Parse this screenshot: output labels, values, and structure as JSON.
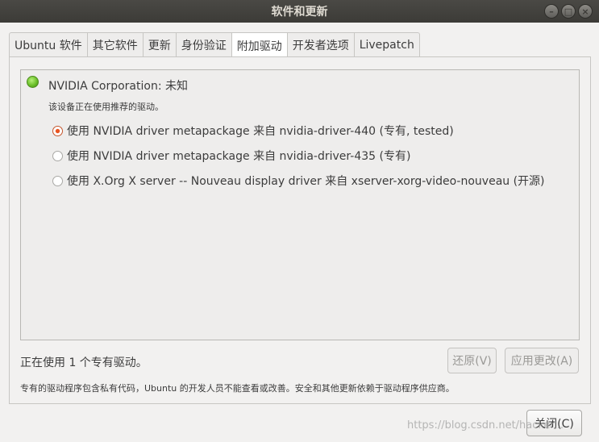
{
  "window": {
    "title": "软件和更新",
    "controls": {
      "minimize": "–",
      "maximize": "□",
      "close": "×"
    }
  },
  "tabs": [
    {
      "label": "Ubuntu 软件"
    },
    {
      "label": "其它软件"
    },
    {
      "label": "更新"
    },
    {
      "label": "身份验证"
    },
    {
      "label": "附加驱动",
      "active": true
    },
    {
      "label": "开发者选项"
    },
    {
      "label": "Livepatch"
    }
  ],
  "device": {
    "name": "NVIDIA Corporation: 未知",
    "status": "该设备正在使用推荐的驱动。",
    "status_indicator_color": "#6cc02a",
    "options": [
      {
        "label": "使用 NVIDIA driver metapackage 来自 nvidia-driver-440 (专有, tested)",
        "selected": true
      },
      {
        "label": "使用 NVIDIA driver metapackage 来自 nvidia-driver-435 (专有)",
        "selected": false
      },
      {
        "label": "使用 X.Org X server -- Nouveau display driver 来自 xserver-xorg-video-nouveau (开源)",
        "selected": false
      }
    ]
  },
  "footer": {
    "status": "正在使用 1 个专有驱动。",
    "revert_label": "还原(V)",
    "apply_label": "应用更改(A)",
    "note": "专有的驱动程序包含私有代码，Ubuntu 的开发人员不能查看或改善。安全和其他更新依赖于驱动程序供应商。"
  },
  "close_label": "关闭(C)",
  "watermark": "https://blog.csdn.net/hacker..."
}
